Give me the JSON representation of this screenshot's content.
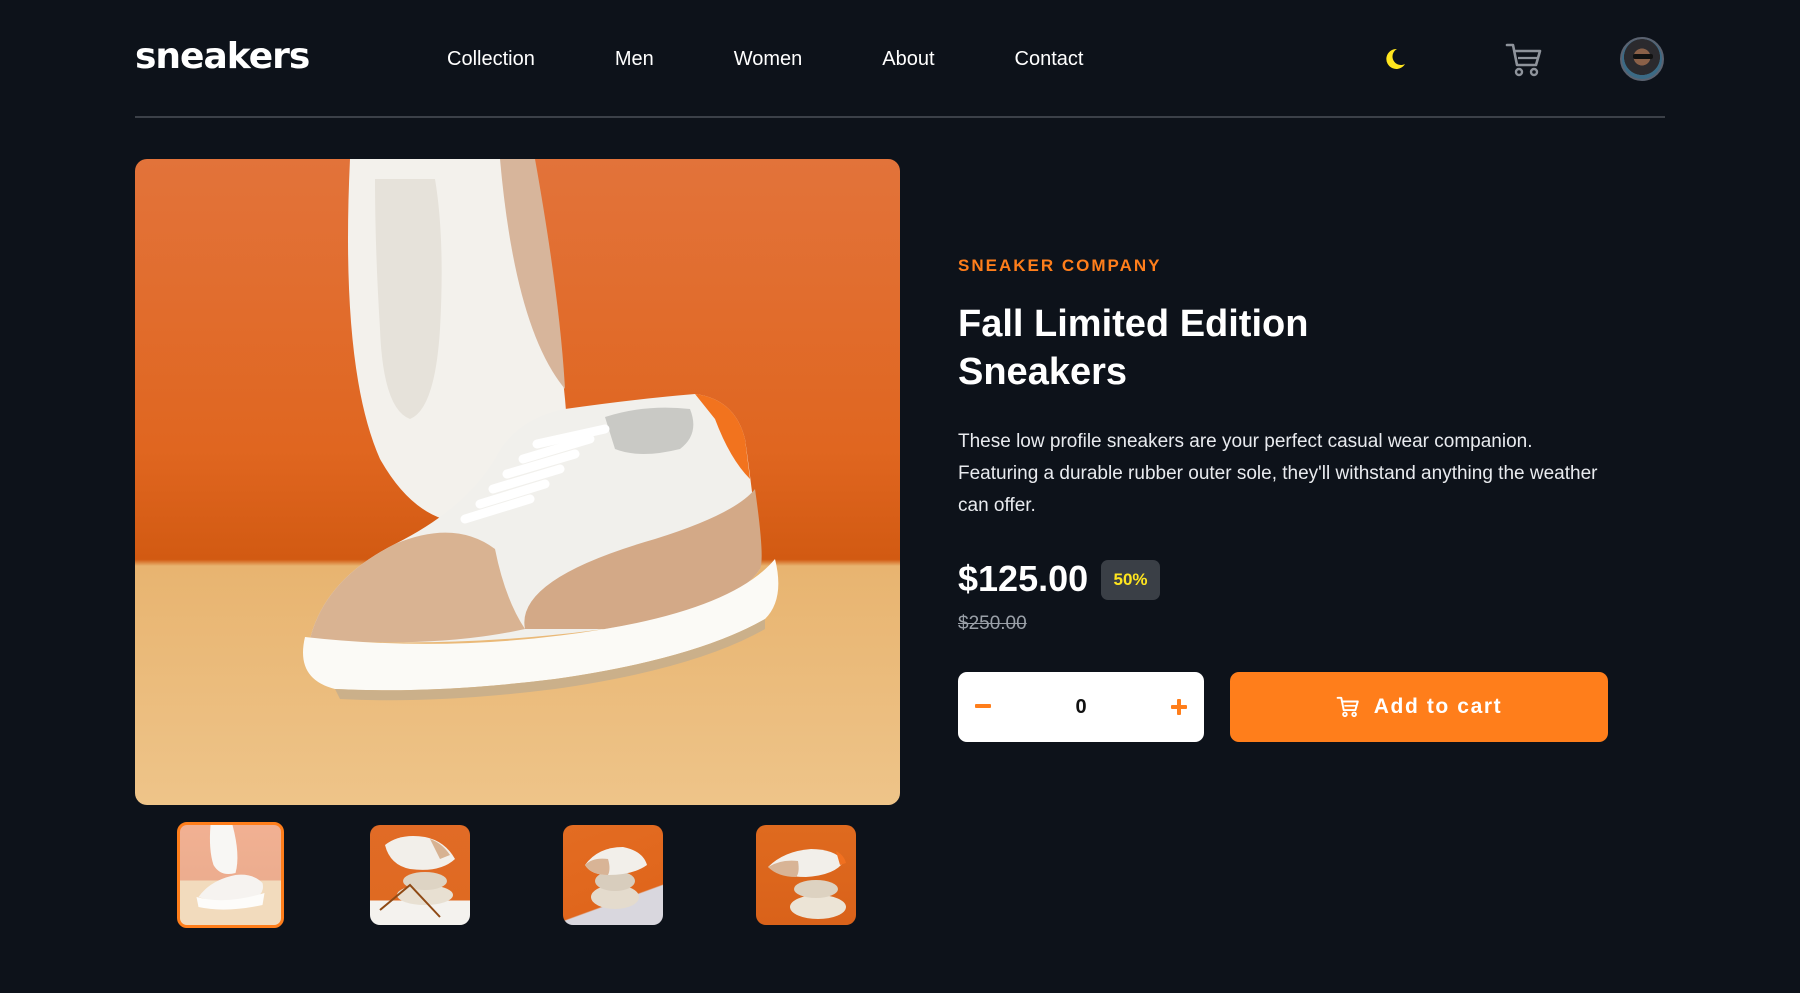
{
  "header": {
    "logo": "sneakers",
    "nav": [
      "Collection",
      "Men",
      "Women",
      "About",
      "Contact"
    ],
    "icons": {
      "theme": "moon-icon",
      "cart": "cart-icon",
      "avatar": "user-avatar"
    }
  },
  "product": {
    "company": "SNEAKER COMPANY",
    "title_line1": "Fall Limited Edition",
    "title_line2": "Sneakers",
    "description": "These low profile sneakers are your perfect casual wear companion. Featuring a durable rubber outer sole, they'll withstand anything the weather can offer.",
    "price": "$125.00",
    "discount": "50%",
    "original_price": "$250.00"
  },
  "cart_controls": {
    "quantity": "0",
    "add_label": "Add to cart"
  },
  "gallery": {
    "thumbnails": 4,
    "active_thumbnail": 1
  },
  "colors": {
    "background": "#0d121a",
    "accent": "#ff7e1b",
    "discount_text": "#ffe51e",
    "discount_bg": "#3a3f46",
    "moon": "#ffe51e"
  }
}
